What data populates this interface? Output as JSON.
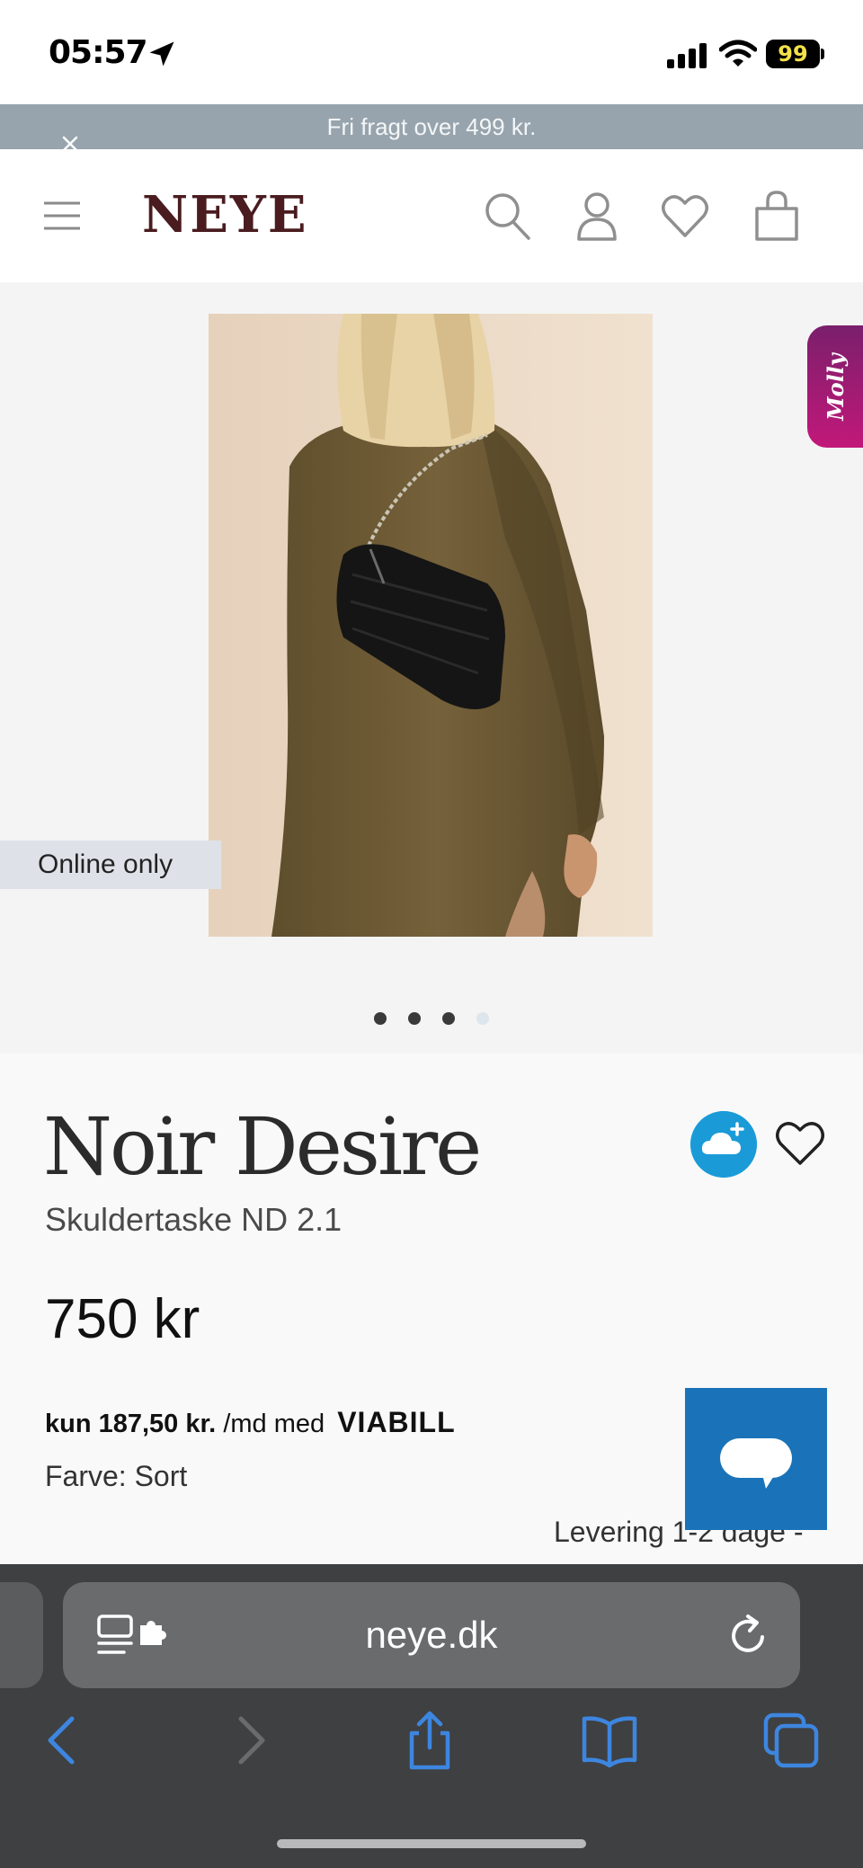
{
  "status_bar": {
    "time": "05:57",
    "battery": "99"
  },
  "promo": {
    "text": "Fri fragt over 499 kr."
  },
  "header": {
    "logo": "NEYE"
  },
  "gallery": {
    "badge": "Online only",
    "side_tab": "Molly",
    "slide_count": 4,
    "active_slide": 4
  },
  "product": {
    "brand": "Noir Desire",
    "name": "Skuldertaske ND 2.1",
    "price": "750 kr",
    "installment_amount": "kun 187,50 kr.",
    "installment_suffix": "/md med",
    "installment_provider": "VIABILL",
    "color_label": "Farve:",
    "color_value": "Sort",
    "delivery": "Levering 1-2 dage -"
  },
  "browser": {
    "url": "neye.dk"
  },
  "colors": {
    "promo_bg": "#97a4ad",
    "logo": "#4a1c1f",
    "chat_button": "#1a73b8",
    "molly_tab": "#c2187a",
    "browser_accent": "#3d86e0"
  },
  "icons": {
    "header": [
      "menu-icon",
      "search-icon",
      "account-icon",
      "wishlist-icon",
      "cart-icon"
    ],
    "product": [
      "cloud-plus-icon",
      "heart-icon",
      "chat-icon"
    ],
    "browser": [
      "back-icon",
      "forward-icon",
      "share-icon",
      "bookmarks-icon",
      "tabs-icon",
      "reader-icon",
      "reload-icon"
    ]
  }
}
